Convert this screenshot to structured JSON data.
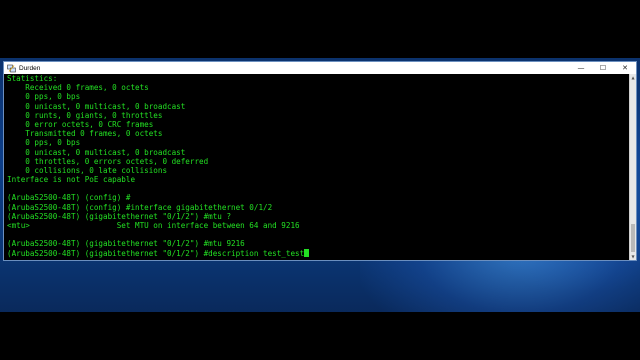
{
  "window": {
    "title": "Durden",
    "controls": {
      "minimize": "—",
      "maximize": "☐",
      "close": "✕"
    }
  },
  "terminal": {
    "lines": [
      "Statistics:",
      "    Received 0 frames, 0 octets",
      "    0 pps, 0 bps",
      "    0 unicast, 0 multicast, 0 broadcast",
      "    0 runts, 0 giants, 0 throttles",
      "    0 error octets, 0 CRC frames",
      "    Transmitted 0 frames, 0 octets",
      "    0 pps, 0 bps",
      "    0 unicast, 0 multicast, 0 broadcast",
      "    0 throttles, 0 errors octets, 0 deferred",
      "    0 collisions, 0 late collisions",
      "Interface is not PoE capable",
      "",
      "(ArubaS2500-48T) (config) #",
      "(ArubaS2500-48T) (config) #interface gigabitethernet 0/1/2",
      "(ArubaS2500-48T) (gigabitethernet \"0/1/2\") #mtu ?",
      "<mtu>                   Set MTU on interface between 64 and 9216",
      "",
      "(ArubaS2500-48T) (gigabitethernet \"0/1/2\") #mtu 9216",
      "(ArubaS2500-48T) (gigabitethernet \"0/1/2\") #description test_test"
    ]
  },
  "colors": {
    "terminal_text": "#23e023",
    "terminal_bg": "#000000",
    "titlebar_bg": "#ffffff"
  },
  "icons": {
    "app": "putty-icon",
    "minimize": "minimize-icon",
    "maximize": "maximize-icon",
    "close": "close-icon"
  }
}
